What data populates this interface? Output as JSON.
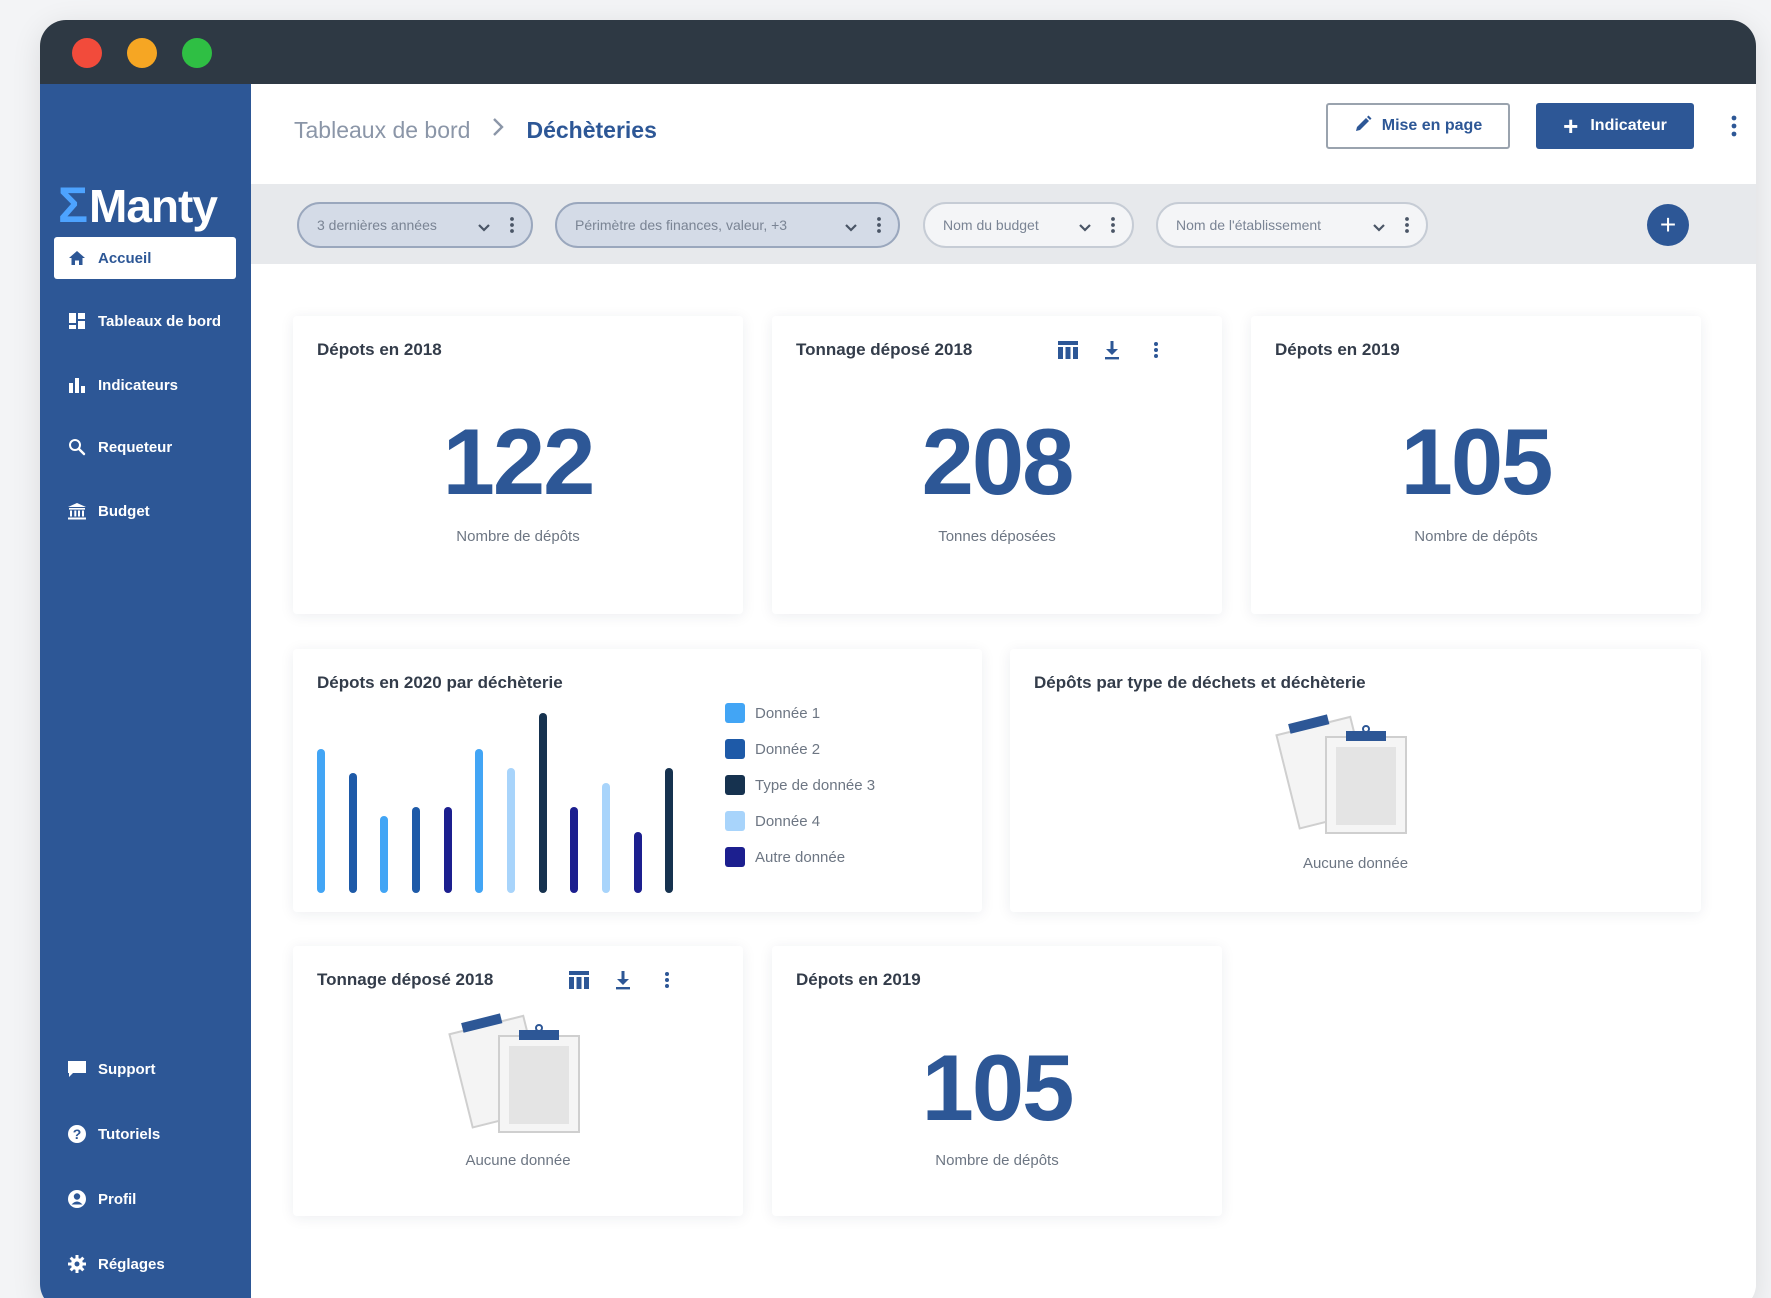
{
  "app": {
    "name": "Manty",
    "logo_mark": "Σ"
  },
  "sidebar": {
    "items": [
      {
        "label": "Accueil",
        "icon": "home-icon",
        "active": true
      },
      {
        "label": "Tableaux de bord",
        "icon": "dashboard-icon"
      },
      {
        "label": "Indicateurs",
        "icon": "bar-chart-icon"
      },
      {
        "label": "Requeteur",
        "icon": "search-icon"
      },
      {
        "label": "Budget",
        "icon": "bank-icon"
      }
    ],
    "bottom_items": [
      {
        "label": "Support",
        "icon": "chat-icon"
      },
      {
        "label": "Tutoriels",
        "icon": "help-icon"
      },
      {
        "label": "Profil",
        "icon": "user-icon"
      },
      {
        "label": "Réglages",
        "icon": "gear-icon"
      }
    ]
  },
  "header": {
    "breadcrumb_parent": "Tableaux de bord",
    "breadcrumb_current": "Déchèteries",
    "layout_button": "Mise en page",
    "add_indicator_button": "Indicateur"
  },
  "filters": [
    {
      "label": "3 dernières années",
      "filled": true
    },
    {
      "label": "Périmètre des finances, valeur, +3",
      "filled": true
    },
    {
      "label": "Nom du budget",
      "filled": false
    },
    {
      "label": "Nom de l'établissement",
      "filled": false
    }
  ],
  "cards": {
    "depots_2018": {
      "title": "Dépots en 2018",
      "value": "122",
      "label": "Nombre de dépôts"
    },
    "tonnage_2018": {
      "title": "Tonnage déposé 2018",
      "value": "208",
      "label": "Tonnes déposées"
    },
    "depots_2019": {
      "title": "Dépots en 2019",
      "value": "105",
      "label": "Nombre de dépôts"
    },
    "chart_card": {
      "title": "Dépots en 2020 par déchèterie"
    },
    "type_card": {
      "title": "Dépôts par type de déchets et déchèterie",
      "empty_label": "Aucune donnée"
    },
    "tonnage_2018_b": {
      "title": "Tonnage déposé 2018",
      "empty_label": "Aucune donnée"
    },
    "depots_2019_b": {
      "title": "Dépots en 2019",
      "value": "105",
      "label": "Nombre de dépôts"
    }
  },
  "colors": {
    "primary": "#2d5796",
    "donnee1": "#42a5f5",
    "donnee2": "#1e5aa8",
    "type3": "#16324f",
    "donnee4": "#a8d4fb",
    "autre": "#1c1f8f"
  },
  "chart_data": {
    "type": "bar",
    "title": "Dépots en 2020 par déchèterie",
    "series": [
      {
        "name": "Donnée 1",
        "color": "#42a5f5"
      },
      {
        "name": "Donnée 2",
        "color": "#1e5aa8"
      },
      {
        "name": "Type de donnée 3",
        "color": "#16324f"
      },
      {
        "name": "Donnée 4",
        "color": "#a8d4fb"
      },
      {
        "name": "Autre donnée",
        "color": "#1c1f8f"
      }
    ],
    "bars": [
      {
        "series": 0,
        "value": 78
      },
      {
        "series": 1,
        "value": 65
      },
      {
        "series": 0,
        "value": 42
      },
      {
        "series": 1,
        "value": 47
      },
      {
        "series": 4,
        "value": 47
      },
      {
        "series": 0,
        "value": 78
      },
      {
        "series": 3,
        "value": 68
      },
      {
        "series": 2,
        "value": 98
      },
      {
        "series": 4,
        "value": 47
      },
      {
        "series": 3,
        "value": 60
      },
      {
        "series": 4,
        "value": 33
      },
      {
        "series": 2,
        "value": 68
      }
    ],
    "ylim": [
      0,
      100
    ]
  }
}
